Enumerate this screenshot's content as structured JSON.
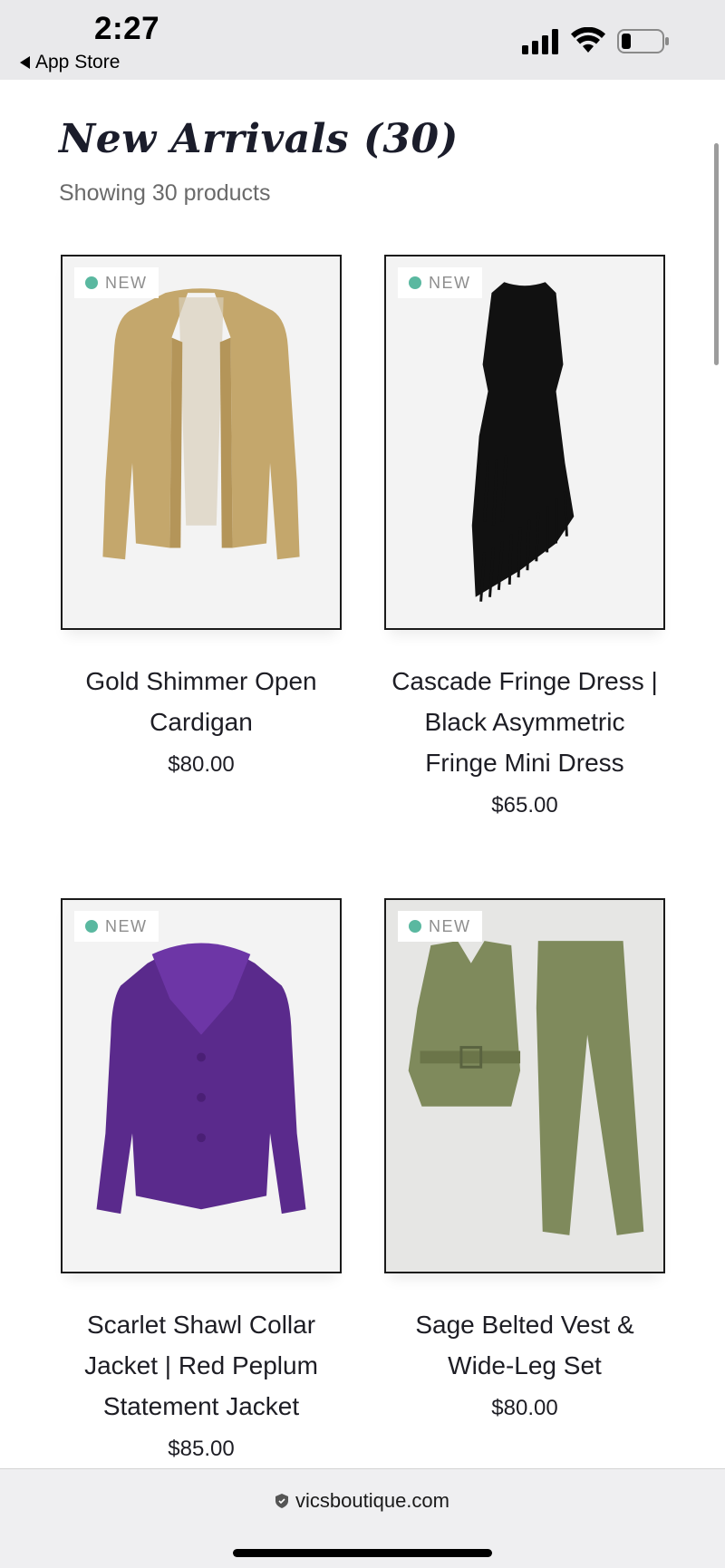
{
  "status_bar": {
    "time": "2:27",
    "back_label": "App Store"
  },
  "page": {
    "title": "New Arrivals (30)",
    "result_count": "Showing 30 products"
  },
  "products": [
    {
      "badge": "NEW",
      "name": "Gold Shimmer Open Cardigan",
      "price": "$80.00"
    },
    {
      "badge": "NEW",
      "name": "Cascade Fringe Dress | Black Asymmetric Fringe Mini Dress",
      "price": "$65.00"
    },
    {
      "badge": "NEW",
      "name": "Scarlet Shawl Collar Jacket | Red Peplum Statement Jacket",
      "price": "$85.00"
    },
    {
      "badge": "NEW",
      "name": "Sage Belted Vest & Wide-Leg Set",
      "price": "$80.00"
    }
  ],
  "browser": {
    "url": "vicsboutique.com"
  },
  "colors": {
    "badge_dot": "#5ab8a0",
    "card_border": "#1a1a1a",
    "cardigan": "#c4a76c",
    "dress": "#111111",
    "jacket": "#5a2a8c",
    "set": "#7f8a5c"
  },
  "icons": [
    "signal-icon",
    "wifi-icon",
    "battery-icon",
    "back-triangle-icon",
    "lock-shield-icon",
    "badge-dot-icon"
  ]
}
